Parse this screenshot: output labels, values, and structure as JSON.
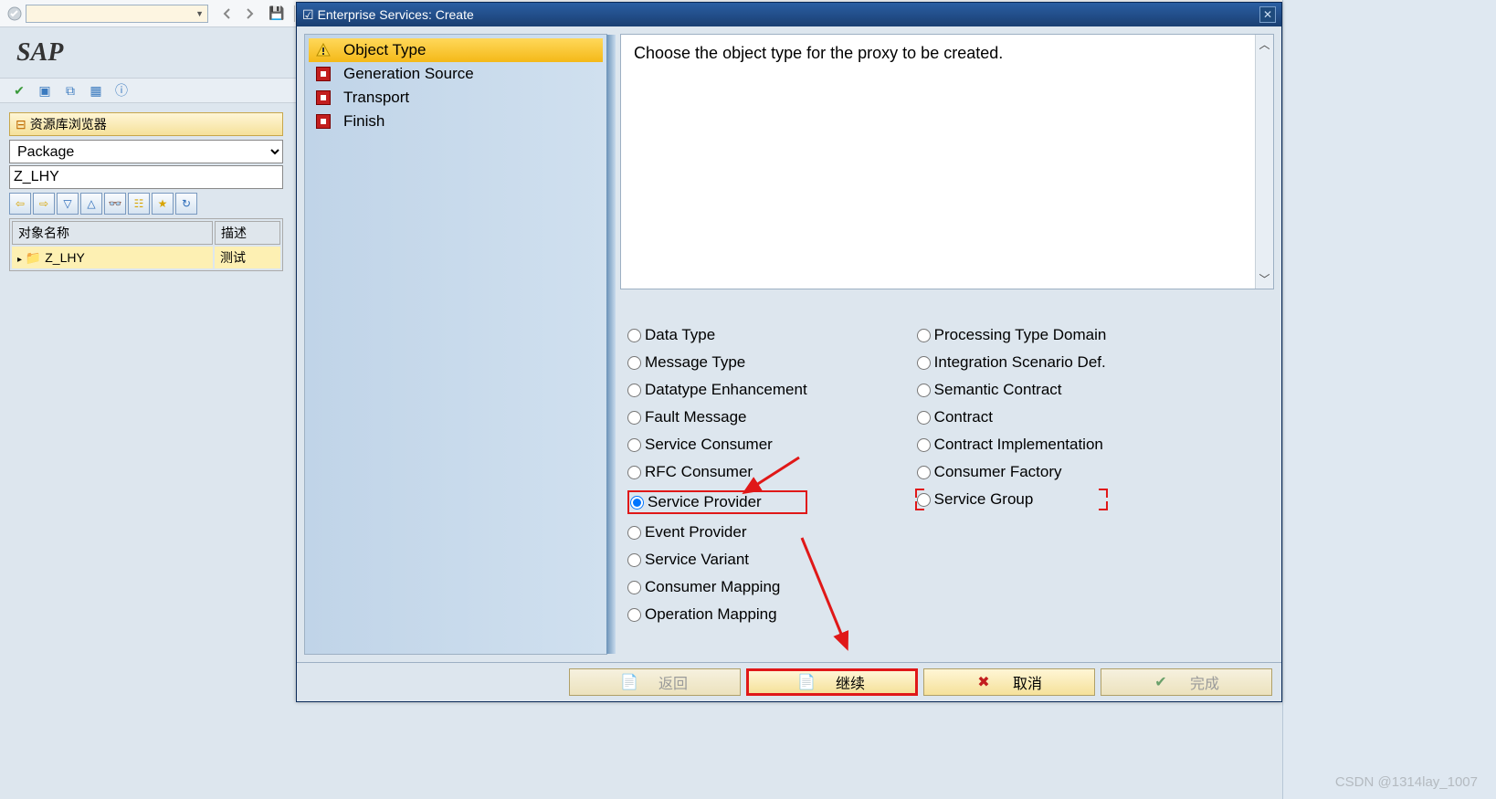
{
  "topbar": {
    "dropdown_value": ""
  },
  "logo": "SAP",
  "repo": {
    "title": "资源库浏览器",
    "type_label": "Package",
    "package_value": "Z_LHY",
    "col_name": "对象名称",
    "col_desc": "描述",
    "row_name": "Z_LHY",
    "row_desc": "测试"
  },
  "modal": {
    "title": "Enterprise Services: Create",
    "steps": [
      "Object Type",
      "Generation Source",
      "Transport",
      "Finish"
    ],
    "instruction": "Choose the object type for the proxy to be created.",
    "radios_left": [
      "Data Type",
      "Message Type",
      "Datatype Enhancement",
      "Fault Message",
      "Service Consumer",
      "RFC Consumer",
      "Service Provider",
      "Event Provider",
      "Service Variant",
      "Consumer Mapping",
      "Operation Mapping"
    ],
    "radios_right": [
      "Processing Type Domain",
      "Integration Scenario Def.",
      "Semantic Contract",
      "Contract",
      "Contract Implementation",
      "Consumer Factory",
      "Service Group"
    ],
    "selected": "Service Provider",
    "highlight_right": "Service Group",
    "buttons": {
      "back": "返回",
      "continue": "继续",
      "cancel": "取消",
      "finish": "完成"
    }
  },
  "watermark": "CSDN @1314lay_1007"
}
